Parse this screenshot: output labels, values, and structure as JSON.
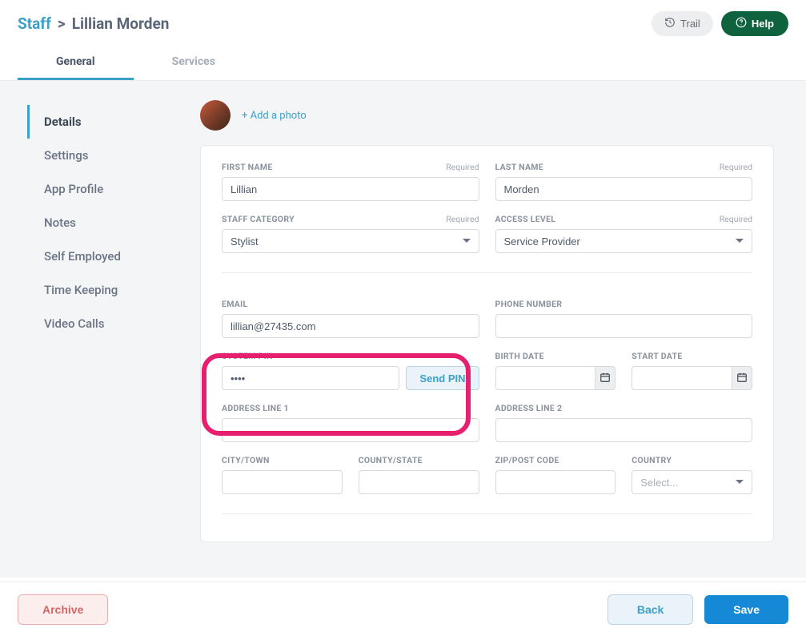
{
  "breadcrumb": {
    "root": "Staff",
    "separator": ">",
    "leaf": "Lillian Morden"
  },
  "header": {
    "trail_label": "Trail",
    "help_label": "Help"
  },
  "tabs": {
    "general": "General",
    "services": "Services"
  },
  "sidebar": {
    "items": [
      {
        "label": "Details"
      },
      {
        "label": "Settings"
      },
      {
        "label": "App Profile"
      },
      {
        "label": "Notes"
      },
      {
        "label": "Self Employed"
      },
      {
        "label": "Time Keeping"
      },
      {
        "label": "Video Calls"
      }
    ]
  },
  "photo": {
    "add_photo": "+ Add a photo"
  },
  "labels": {
    "first_name": "FIRST NAME",
    "last_name": "LAST NAME",
    "staff_category": "STAFF CATEGORY",
    "access_level": "ACCESS LEVEL",
    "email": "EMAIL",
    "phone_number": "PHONE NUMBER",
    "system_pin": "SYSTEM PIN",
    "birth_date": "BIRTH DATE",
    "start_date": "START DATE",
    "address1": "ADDRESS LINE 1",
    "address2": "ADDRESS LINE 2",
    "city": "CITY/TOWN",
    "county": "COUNTY/STATE",
    "zip": "ZIP/POST CODE",
    "country": "COUNTRY",
    "required": "Required"
  },
  "values": {
    "first_name": "Lillian",
    "last_name": "Morden",
    "staff_category": "Stylist",
    "access_level": "Service Provider",
    "email": "lillian@27435.com",
    "phone_number": "",
    "system_pin": "••••",
    "birth_date": "",
    "start_date": "",
    "address1": "",
    "address2": "",
    "city": "",
    "county": "",
    "zip": "",
    "country_placeholder": "Select...",
    "send_pin": "Send PIN"
  },
  "footer": {
    "archive": "Archive",
    "back": "Back",
    "save": "Save"
  }
}
